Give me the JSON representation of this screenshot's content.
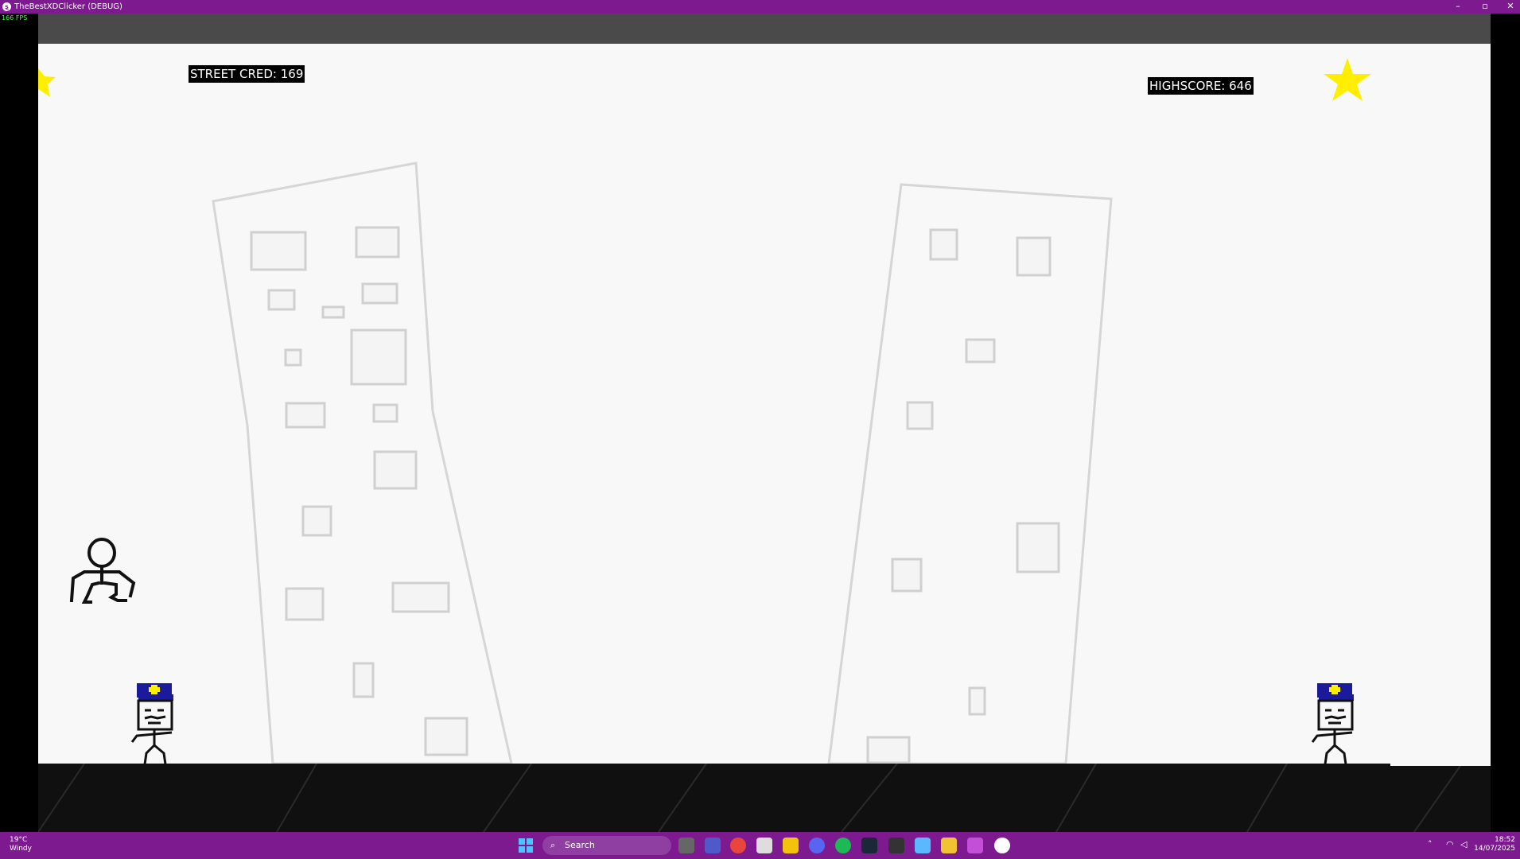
{
  "window": {
    "title": "TheBestXDClicker (DEBUG)",
    "app_icon": "xd-smiley-icon",
    "minimize_icon": "–",
    "maximize_icon": "▫",
    "close_icon": "✕"
  },
  "debug": {
    "fps": "166 FPS"
  },
  "hud": {
    "street_cred": "STREET CRED: 169",
    "highscore": "HIGHSCORE: 646"
  },
  "colors": {
    "titlebar": "#7d1a8f",
    "star": "#ffee00",
    "police_hat": "#1a1a9a",
    "background": "#f8f8f8",
    "ground": "#101010"
  },
  "taskbar": {
    "weather_temp": "19°C",
    "weather_desc": "Windy",
    "search_placeholder": "Search",
    "time": "18:52",
    "date": "14/07/2025",
    "apps": [
      "start-icon",
      "task-view-icon",
      "teams-icon",
      "chrome-icon",
      "store-icon",
      "file-explorer-icon",
      "discord-icon",
      "spotify-icon",
      "steam-icon",
      "calculator-icon",
      "notepad-icon",
      "pen-icon",
      "copilot-icon",
      "game-icon"
    ]
  }
}
